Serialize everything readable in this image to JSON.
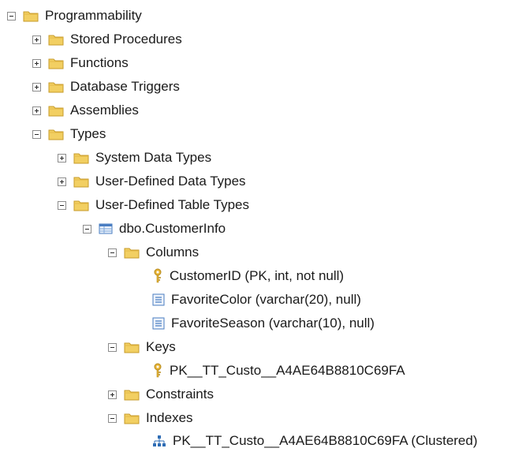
{
  "tree": {
    "programmability": "Programmability",
    "stored_procedures": "Stored Procedures",
    "functions": "Functions",
    "database_triggers": "Database Triggers",
    "assemblies": "Assemblies",
    "types": "Types",
    "system_data_types": "System Data Types",
    "user_defined_data_types": "User-Defined Data Types",
    "user_defined_table_types": "User-Defined Table Types",
    "table_type": "dbo.CustomerInfo",
    "columns": "Columns",
    "column_1": "CustomerID (PK, int, not null)",
    "column_2": "FavoriteColor (varchar(20), null)",
    "column_3": "FavoriteSeason (varchar(10), null)",
    "keys": "Keys",
    "key_1": "PK__TT_Custo__A4AE64B8810C69FA",
    "constraints": "Constraints",
    "indexes": "Indexes",
    "index_1": "PK__TT_Custo__A4AE64B8810C69FA (Clustered)"
  },
  "icons": {
    "folder": "folder-icon",
    "table": "table-icon",
    "key": "key-icon",
    "column": "column-icon",
    "index": "index-icon"
  },
  "colors": {
    "folder_fill": "#f2cf62",
    "folder_border": "#c79b2a",
    "key_gold": "#e8b437",
    "column_blue": "#4a7ec2",
    "index_blue": "#2f6db5"
  }
}
